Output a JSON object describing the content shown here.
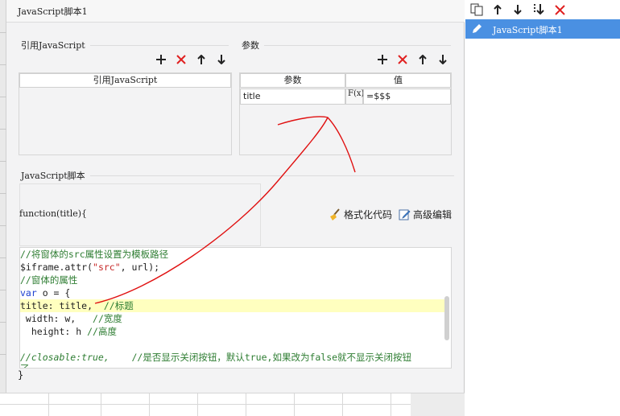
{
  "dialog": {
    "title": "JavaScript脚本1"
  },
  "ref_section": {
    "label": "引用JavaScript",
    "column_header": "引用JavaScript"
  },
  "param_section": {
    "label": "参数",
    "columns": [
      "参数",
      "值"
    ],
    "rows": [
      {
        "name": "title",
        "fx": "F(x)",
        "value": "=$$$"
      }
    ]
  },
  "script_section": {
    "label": "JavaScript脚本",
    "signature": "function(title){",
    "format_label": "格式化代码",
    "advanced_label": "高级编辑",
    "closing": "}"
  },
  "code": {
    "lines": [
      {
        "text": "//将窗体的src属性设置为模板路径",
        "style": "comment"
      },
      {
        "text": "$iframe.attr(\"src\", url);",
        "style": "mixed-string"
      },
      {
        "text": "//窗体的属性",
        "style": "comment"
      },
      {
        "text": "var o = {",
        "style": "keyword"
      },
      {
        "text": "title: title,",
        "comment": "  //标题",
        "style": "highlight"
      },
      {
        "text": " width: w,",
        "comment": "   //宽度",
        "style": "plain-comment"
      },
      {
        "text": "  height: h",
        "comment": " //高度",
        "style": "plain-comment"
      },
      {
        "text": "",
        "style": "plain"
      },
      {
        "text": "//closable:true,",
        "comment": "    //是否显示关闭按钮，默认true,如果改为false就不显示关闭按钮",
        "style": "comment-italic"
      },
      {
        "text": "了",
        "style": "comment"
      }
    ]
  },
  "right_panel": {
    "item_label": "JavaScript脚本1"
  },
  "colors": {
    "accent": "#4a90e2",
    "delete": "#e02020",
    "annotation": "#e01010",
    "highlight": "#ffffbf",
    "comment": "#2e7d32",
    "keyword": "#1c3fd0"
  }
}
